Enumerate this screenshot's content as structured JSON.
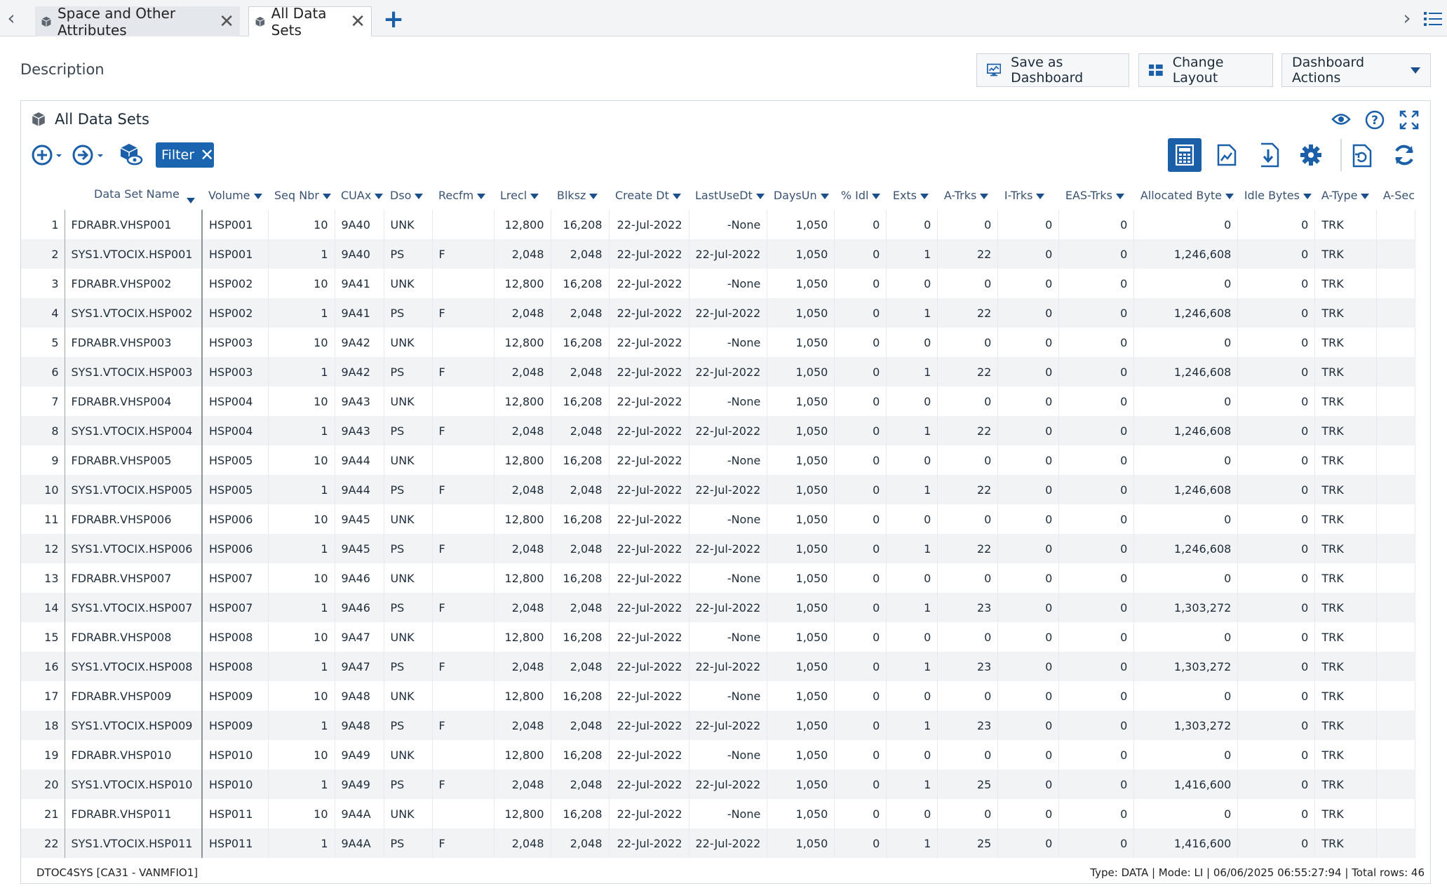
{
  "tabs": [
    {
      "label": "Space and Other Attributes",
      "active": false
    },
    {
      "label": "All Data Sets",
      "active": true
    }
  ],
  "header": {
    "description": "Description",
    "save_dashboard": "Save as Dashboard",
    "change_layout": "Change Layout",
    "dashboard_actions": "Dashboard Actions"
  },
  "panel": {
    "title": "All Data Sets",
    "filter_label": "Filter"
  },
  "columns": [
    "Data Set Name",
    "Volume",
    "Seq Nbr",
    "CUAx",
    "Dso",
    "Recfm",
    "Lrecl",
    "Blksz",
    "Create Dt",
    "LastUseDt",
    "DaysUn",
    "% Idl",
    "Exts",
    "A-Trks",
    "I-Trks",
    "EAS-Trks",
    "Allocated Byte",
    "Idle Bytes",
    "A-Type",
    "A-Sec"
  ],
  "rows": [
    [
      "1",
      "FDRABR.VHSP001",
      "HSP001",
      "10",
      "9A40",
      "UNK",
      "",
      "12,800",
      "16,208",
      "22-Jul-2022",
      "-None",
      "1,050",
      "0",
      "0",
      "0",
      "0",
      "0",
      "0",
      "0",
      "TRK"
    ],
    [
      "2",
      "SYS1.VTOCIX.HSP001",
      "HSP001",
      "1",
      "9A40",
      "PS",
      "F",
      "2,048",
      "2,048",
      "22-Jul-2022",
      "22-Jul-2022",
      "1,050",
      "0",
      "1",
      "22",
      "0",
      "0",
      "1,246,608",
      "0",
      "TRK"
    ],
    [
      "3",
      "FDRABR.VHSP002",
      "HSP002",
      "10",
      "9A41",
      "UNK",
      "",
      "12,800",
      "16,208",
      "22-Jul-2022",
      "-None",
      "1,050",
      "0",
      "0",
      "0",
      "0",
      "0",
      "0",
      "0",
      "TRK"
    ],
    [
      "4",
      "SYS1.VTOCIX.HSP002",
      "HSP002",
      "1",
      "9A41",
      "PS",
      "F",
      "2,048",
      "2,048",
      "22-Jul-2022",
      "22-Jul-2022",
      "1,050",
      "0",
      "1",
      "22",
      "0",
      "0",
      "1,246,608",
      "0",
      "TRK"
    ],
    [
      "5",
      "FDRABR.VHSP003",
      "HSP003",
      "10",
      "9A42",
      "UNK",
      "",
      "12,800",
      "16,208",
      "22-Jul-2022",
      "-None",
      "1,050",
      "0",
      "0",
      "0",
      "0",
      "0",
      "0",
      "0",
      "TRK"
    ],
    [
      "6",
      "SYS1.VTOCIX.HSP003",
      "HSP003",
      "1",
      "9A42",
      "PS",
      "F",
      "2,048",
      "2,048",
      "22-Jul-2022",
      "22-Jul-2022",
      "1,050",
      "0",
      "1",
      "22",
      "0",
      "0",
      "1,246,608",
      "0",
      "TRK"
    ],
    [
      "7",
      "FDRABR.VHSP004",
      "HSP004",
      "10",
      "9A43",
      "UNK",
      "",
      "12,800",
      "16,208",
      "22-Jul-2022",
      "-None",
      "1,050",
      "0",
      "0",
      "0",
      "0",
      "0",
      "0",
      "0",
      "TRK"
    ],
    [
      "8",
      "SYS1.VTOCIX.HSP004",
      "HSP004",
      "1",
      "9A43",
      "PS",
      "F",
      "2,048",
      "2,048",
      "22-Jul-2022",
      "22-Jul-2022",
      "1,050",
      "0",
      "1",
      "22",
      "0",
      "0",
      "1,246,608",
      "0",
      "TRK"
    ],
    [
      "9",
      "FDRABR.VHSP005",
      "HSP005",
      "10",
      "9A44",
      "UNK",
      "",
      "12,800",
      "16,208",
      "22-Jul-2022",
      "-None",
      "1,050",
      "0",
      "0",
      "0",
      "0",
      "0",
      "0",
      "0",
      "TRK"
    ],
    [
      "10",
      "SYS1.VTOCIX.HSP005",
      "HSP005",
      "1",
      "9A44",
      "PS",
      "F",
      "2,048",
      "2,048",
      "22-Jul-2022",
      "22-Jul-2022",
      "1,050",
      "0",
      "1",
      "22",
      "0",
      "0",
      "1,246,608",
      "0",
      "TRK"
    ],
    [
      "11",
      "FDRABR.VHSP006",
      "HSP006",
      "10",
      "9A45",
      "UNK",
      "",
      "12,800",
      "16,208",
      "22-Jul-2022",
      "-None",
      "1,050",
      "0",
      "0",
      "0",
      "0",
      "0",
      "0",
      "0",
      "TRK"
    ],
    [
      "12",
      "SYS1.VTOCIX.HSP006",
      "HSP006",
      "1",
      "9A45",
      "PS",
      "F",
      "2,048",
      "2,048",
      "22-Jul-2022",
      "22-Jul-2022",
      "1,050",
      "0",
      "1",
      "22",
      "0",
      "0",
      "1,246,608",
      "0",
      "TRK"
    ],
    [
      "13",
      "FDRABR.VHSP007",
      "HSP007",
      "10",
      "9A46",
      "UNK",
      "",
      "12,800",
      "16,208",
      "22-Jul-2022",
      "-None",
      "1,050",
      "0",
      "0",
      "0",
      "0",
      "0",
      "0",
      "0",
      "TRK"
    ],
    [
      "14",
      "SYS1.VTOCIX.HSP007",
      "HSP007",
      "1",
      "9A46",
      "PS",
      "F",
      "2,048",
      "2,048",
      "22-Jul-2022",
      "22-Jul-2022",
      "1,050",
      "0",
      "1",
      "23",
      "0",
      "0",
      "1,303,272",
      "0",
      "TRK"
    ],
    [
      "15",
      "FDRABR.VHSP008",
      "HSP008",
      "10",
      "9A47",
      "UNK",
      "",
      "12,800",
      "16,208",
      "22-Jul-2022",
      "-None",
      "1,050",
      "0",
      "0",
      "0",
      "0",
      "0",
      "0",
      "0",
      "TRK"
    ],
    [
      "16",
      "SYS1.VTOCIX.HSP008",
      "HSP008",
      "1",
      "9A47",
      "PS",
      "F",
      "2,048",
      "2,048",
      "22-Jul-2022",
      "22-Jul-2022",
      "1,050",
      "0",
      "1",
      "23",
      "0",
      "0",
      "1,303,272",
      "0",
      "TRK"
    ],
    [
      "17",
      "FDRABR.VHSP009",
      "HSP009",
      "10",
      "9A48",
      "UNK",
      "",
      "12,800",
      "16,208",
      "22-Jul-2022",
      "-None",
      "1,050",
      "0",
      "0",
      "0",
      "0",
      "0",
      "0",
      "0",
      "TRK"
    ],
    [
      "18",
      "SYS1.VTOCIX.HSP009",
      "HSP009",
      "1",
      "9A48",
      "PS",
      "F",
      "2,048",
      "2,048",
      "22-Jul-2022",
      "22-Jul-2022",
      "1,050",
      "0",
      "1",
      "23",
      "0",
      "0",
      "1,303,272",
      "0",
      "TRK"
    ],
    [
      "19",
      "FDRABR.VHSP010",
      "HSP010",
      "10",
      "9A49",
      "UNK",
      "",
      "12,800",
      "16,208",
      "22-Jul-2022",
      "-None",
      "1,050",
      "0",
      "0",
      "0",
      "0",
      "0",
      "0",
      "0",
      "TRK"
    ],
    [
      "20",
      "SYS1.VTOCIX.HSP010",
      "HSP010",
      "1",
      "9A49",
      "PS",
      "F",
      "2,048",
      "2,048",
      "22-Jul-2022",
      "22-Jul-2022",
      "1,050",
      "0",
      "1",
      "25",
      "0",
      "0",
      "1,416,600",
      "0",
      "TRK"
    ],
    [
      "21",
      "FDRABR.VHSP011",
      "HSP011",
      "10",
      "9A4A",
      "UNK",
      "",
      "12,800",
      "16,208",
      "22-Jul-2022",
      "-None",
      "1,050",
      "0",
      "0",
      "0",
      "0",
      "0",
      "0",
      "0",
      "TRK"
    ],
    [
      "22",
      "SYS1.VTOCIX.HSP011",
      "HSP011",
      "1",
      "9A4A",
      "PS",
      "F",
      "2,048",
      "2,048",
      "22-Jul-2022",
      "22-Jul-2022",
      "1,050",
      "0",
      "1",
      "25",
      "0",
      "0",
      "1,416,600",
      "0",
      "TRK"
    ]
  ],
  "footer": {
    "system": "DTOC4SYS [CA31 - VANMFIO1]",
    "status": "Type: DATA  |  Mode: LI  |  06/06/2025 06:55:27:94  |  Total rows: 46"
  }
}
